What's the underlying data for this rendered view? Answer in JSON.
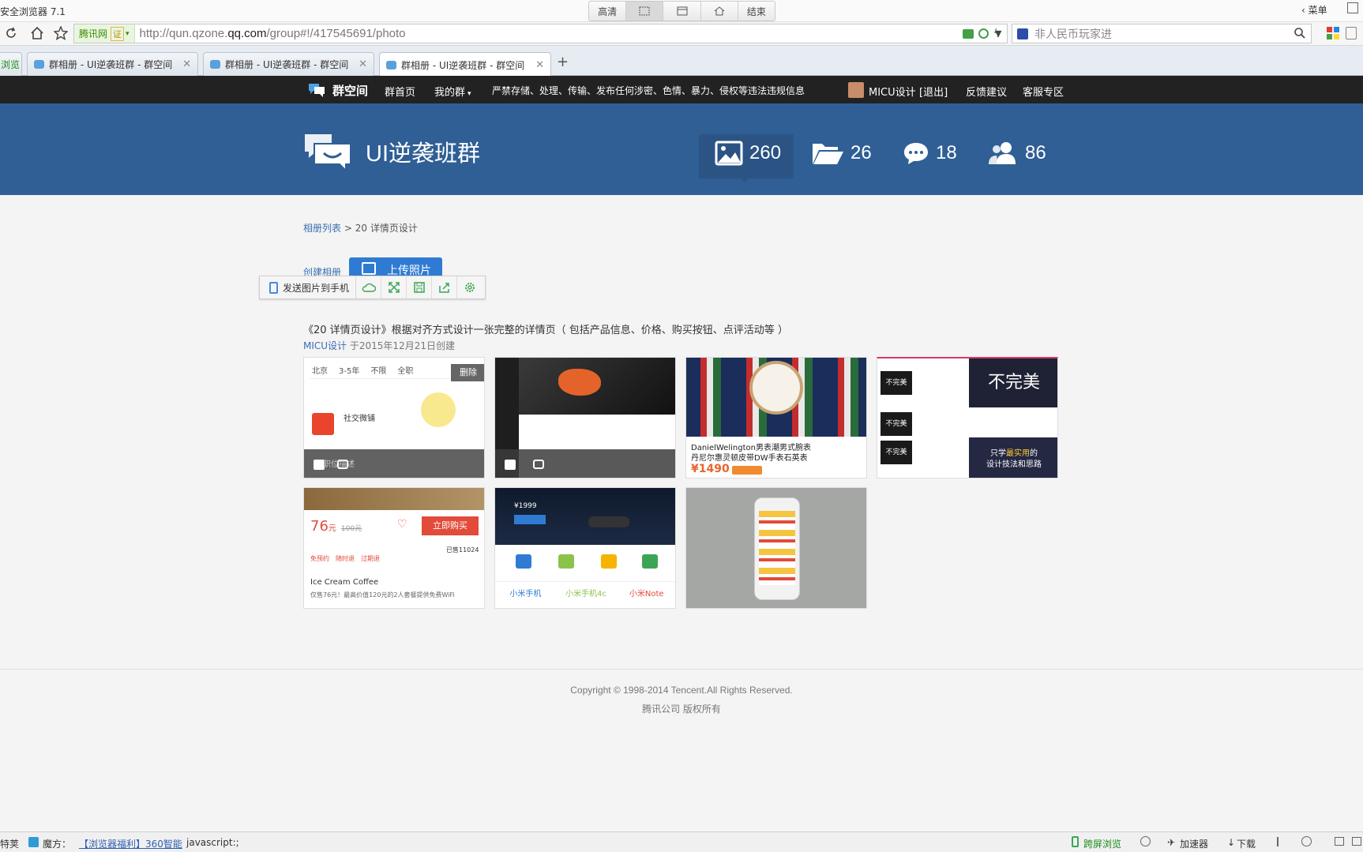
{
  "browser": {
    "title": "安全浏览器 7.1",
    "tools": [
      "高清",
      "",
      "",
      "",
      "结束"
    ],
    "menu_label": "菜单",
    "site_badge": "腾讯网",
    "site_badge_extra": "证",
    "url_prefix": "http://qun.qzone.",
    "url_domain": "qq.com",
    "url_suffix": "/group#!/417545691/photo",
    "search_placeholder": "非人民币玩家进",
    "tabs": [
      {
        "label": "浏览"
      },
      {
        "label": "群相册 - UI逆袭班群 - 群空间"
      },
      {
        "label": "群相册 - UI逆袭班群 - 群空间"
      },
      {
        "label": "群相册 - UI逆袭班群 - 群空间"
      }
    ],
    "new_tab": "+"
  },
  "topnav": {
    "brand": "群空间",
    "home": "群首页",
    "my_groups": "我的群",
    "notice": "严禁存储、处理、传输、发布任何涉密、色情、暴力、侵权等违法违规信息",
    "user": "MICU设计",
    "logout": "[退出]",
    "feedback": "反馈建议",
    "service": "客服专区"
  },
  "banner": {
    "group_name": "UI逆袭班群",
    "stats": {
      "photos": "260",
      "albums": "26",
      "comments": "18",
      "members": "86"
    }
  },
  "breadcrumb": {
    "link": "相册列表",
    "sep": ">",
    "current": "20 详情页设计"
  },
  "actions": {
    "create_album": "创建相册",
    "upload": "上传照片",
    "send_to_phone": "发送图片到手机"
  },
  "album": {
    "title": "《20 详情页设计》根据对齐方式设计一张完整的详情页（ 包括产品信息、价格、购买按钮、点评活动等 ）",
    "author": "MICU设计",
    "created": "于2015年12月21日创建"
  },
  "photos": {
    "p1": {
      "delete": "删除",
      "tags": [
        "北京",
        "3-5年",
        "不限",
        "全职"
      ],
      "company": "社交微铺",
      "caption": "职位描述"
    },
    "p3": {
      "name": "DanielWelington男表潮男式腕表",
      "name2": "丹尼尔惠灵顿皮带DW手表石英表",
      "price": "¥1490"
    },
    "p4": {
      "brand": "不完美",
      "text1": "只学",
      "text_hl": "最实用",
      "text2": "的",
      "text3": "设计技法和思路"
    },
    "p5": {
      "price": "76",
      "unit": "元",
      "old": "100元",
      "buy": "立即购买",
      "sold": "已售11024",
      "shop": "Ice Cream Coffee",
      "desc": "仅售76元！最高价值120元的2人套餐提供免费WiFi",
      "tags": [
        "免预约",
        "随时退",
        "过期退"
      ]
    },
    "p6": {
      "price": "¥1999",
      "products": [
        "小米手机",
        "小米手机4c",
        "小米Note"
      ]
    }
  },
  "footer": {
    "copyright": "Copyright © 1998-2014 Tencent.All Rights Reserved.",
    "company": "腾讯公司 版权所有"
  },
  "statusbar": {
    "left": "特荚",
    "magic": "魔方：",
    "promo": "【浏览器福利】360智能",
    "status": "javascript:;",
    "cross": "跨屏浏览",
    "accel": "加速器",
    "download": "下载"
  }
}
